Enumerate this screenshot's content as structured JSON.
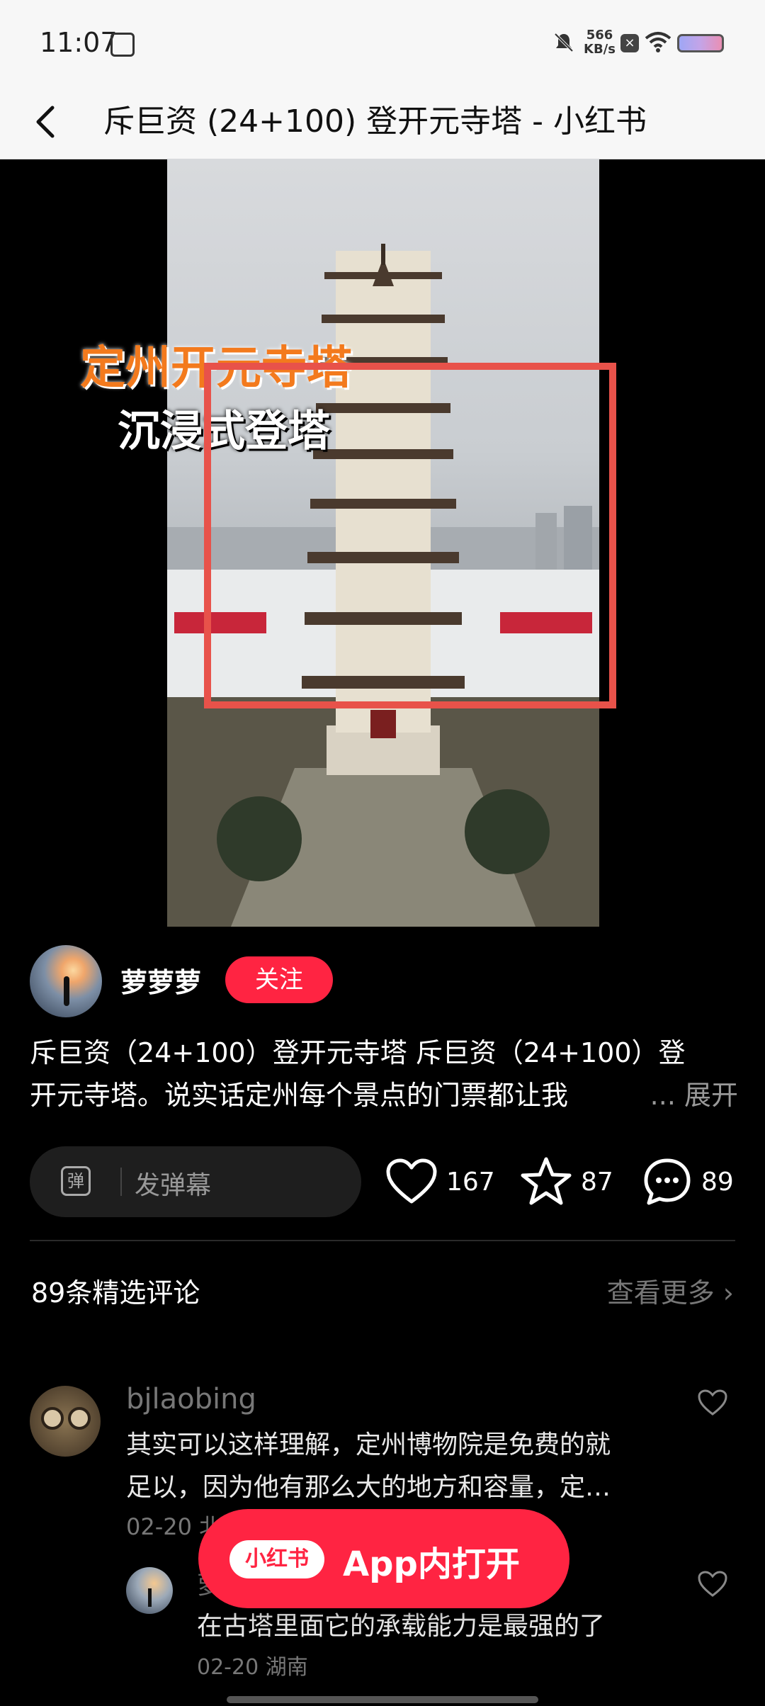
{
  "status_bar": {
    "time": "11:07",
    "net_speed_value": "566",
    "net_speed_unit": "KB/s"
  },
  "header": {
    "title": "斥巨资 (24+100) 登开元寺塔 - 小红书"
  },
  "media": {
    "caption_line1": "定州开元寺塔",
    "caption_line2": "沉浸式登塔"
  },
  "author": {
    "name": "萝萝萝",
    "follow_label": "关注"
  },
  "post": {
    "desc_line1": "斥巨资（24+100）登开元寺塔 斥巨资（24+100）登",
    "desc_line2": "开元寺塔。说实话定州每个景点的门票都让我",
    "more_label": "... 展开"
  },
  "actions": {
    "danmu_icon_text": "弹",
    "danmu_placeholder": "发弹幕",
    "likes": "167",
    "collects": "87",
    "comments": "89"
  },
  "comments_section": {
    "count_label": "89条精选评论",
    "see_more_label": "查看更多 ›",
    "items": [
      {
        "user": "bjlaobing",
        "text_line1": "其实可以这样理解，定州博物院是免费的就",
        "text_line2": "足以，因为他有那么大的地方和容量，定…",
        "date": "02-20 北"
      }
    ],
    "reply": {
      "user": "萝",
      "text": "在古塔里面它的承载能力是最强的了",
      "date": "02-20 湖南"
    }
  },
  "open_app": {
    "logo_text": "小红书",
    "label": "App内打开"
  }
}
